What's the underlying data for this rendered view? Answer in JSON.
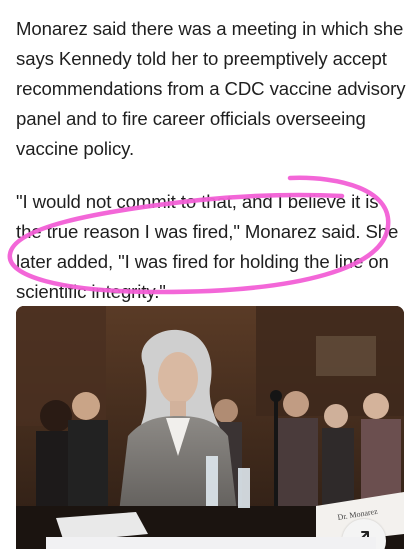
{
  "article": {
    "paragraphs": [
      "Monarez said there was a meeting in which she says Kennedy told her to preemptively accept recommendations from a CDC vaccine advisory panel and to fire career officials overseeing vaccine policy.",
      "\"I would not commit to that, and I believe it is the true reason I was fired,\" Monarez said. She later added, \"I was fired for holding the line on scientific integrity.\""
    ]
  },
  "photo": {
    "nameplate_text": "Dr. Monarez"
  },
  "colors": {
    "highlight": "#f25fd6",
    "text": "#1f1f1f"
  },
  "icons": {
    "expand": "arrow-up-right-icon"
  }
}
